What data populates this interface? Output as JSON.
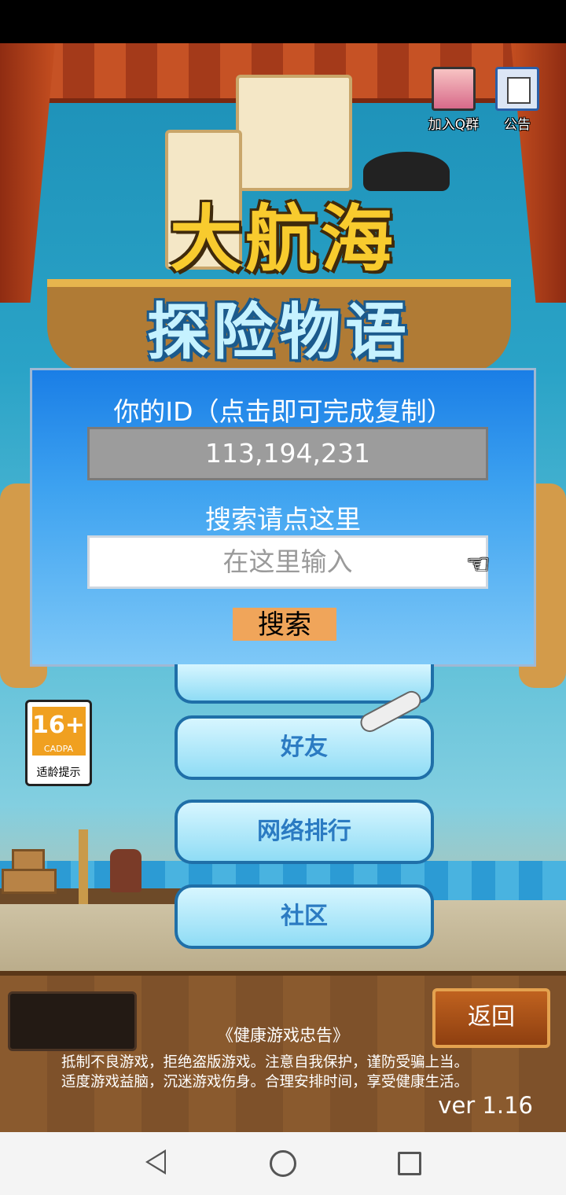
{
  "top_icons": {
    "join_group_label": "加入Q群",
    "announcement_label": "公告"
  },
  "logo": {
    "line1": "大航海",
    "line2": "探险物语"
  },
  "dialog": {
    "title": "你的ID（点击即可完成复制）",
    "id_value": "113,194,231",
    "search_label": "搜索请点这里",
    "search_placeholder": "在这里输入",
    "search_button": "搜索"
  },
  "menu": {
    "items": [
      "好友",
      "网络排行",
      "社区"
    ]
  },
  "age_rating": {
    "number": "16+",
    "org": "CADPA",
    "tip": "适龄提示"
  },
  "bottom": {
    "back_button": "返回",
    "health_title": "《健康游戏忠告》",
    "health_line1": "抵制不良游戏，拒绝盗版游戏。注意自我保护，谨防受骗上当。",
    "health_line2": "适度游戏益脑，沉迷游戏伤身。合理安排时间，享受健康生活。",
    "version": "ver 1.16"
  },
  "colors": {
    "dialog_blue": "#1a7ee6",
    "search_button_orange": "#f0a55a",
    "menu_text_blue": "#2b7bc2",
    "back_button_brown": "#8e3f10"
  }
}
